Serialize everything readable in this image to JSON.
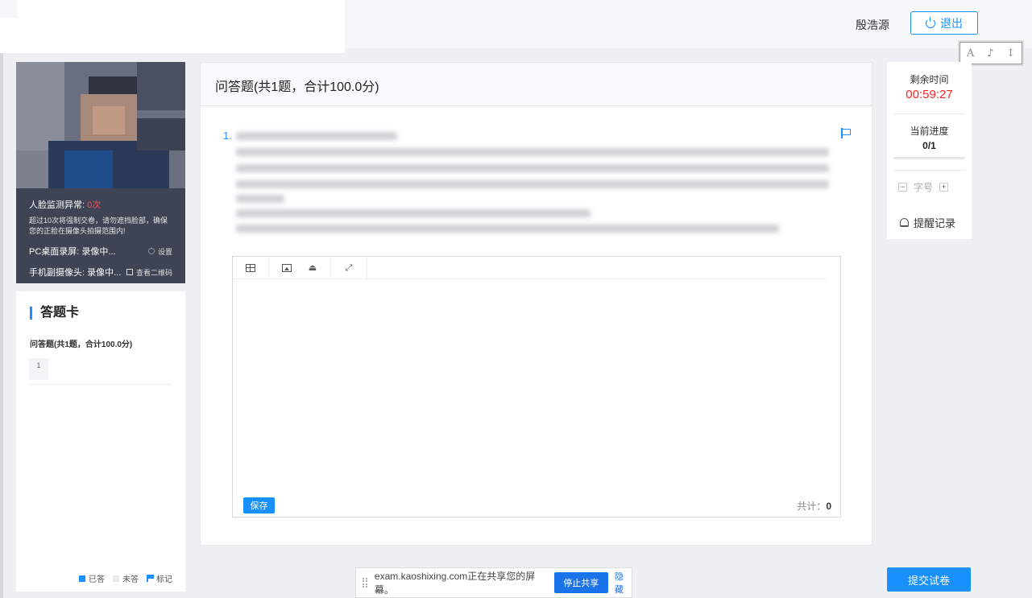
{
  "header": {
    "user_name": "殷浩源",
    "logout_label": "退出",
    "font_tools": [
      "A",
      "♪",
      "↕"
    ]
  },
  "camera": {
    "warning_label": "人脸监测异常:",
    "warning_count": "0次",
    "warning_desc": "超过10次将强制交卷，请勿遮挡脸部，确保您的正脸在摄像头拍摄范围内!",
    "pc_record": "PC桌面录屏: 录像中...",
    "settings_label": "设置",
    "phone_record": "手机副摄像头: 录像中...",
    "qr_label": "查看二维码"
  },
  "answer_card": {
    "title": "答题卡",
    "section": "问答题(共1题，合计100.0分)",
    "questions": [
      "1"
    ],
    "legend": {
      "answered": "已答",
      "unanswered": "未答",
      "marked": "标记"
    },
    "colors": {
      "answered": "#1890ff",
      "unanswered": "#e8eaee"
    }
  },
  "main": {
    "section_title": "问答题(共1题，合计100.0分)",
    "question_number": "1.",
    "save_label": "保存",
    "count_label": "共计：",
    "count_value": "0"
  },
  "right_panel": {
    "remaining_label": "剩余时间",
    "remaining_time": "00:59:27",
    "progress_label": "当前进度",
    "progress_value": "0/1",
    "progress_fraction": 0,
    "font_label": "字号",
    "remind_label": "提醒记录"
  },
  "submit_label": "提交试卷",
  "share_bar": {
    "message": "exam.kaoshixing.com正在共享您的屏幕。",
    "stop_label": "停止共享",
    "hide_label": "隐藏"
  },
  "colors": {
    "accent": "#1890ff",
    "timer": "#ff2020",
    "warning": "#ff4d4f"
  }
}
